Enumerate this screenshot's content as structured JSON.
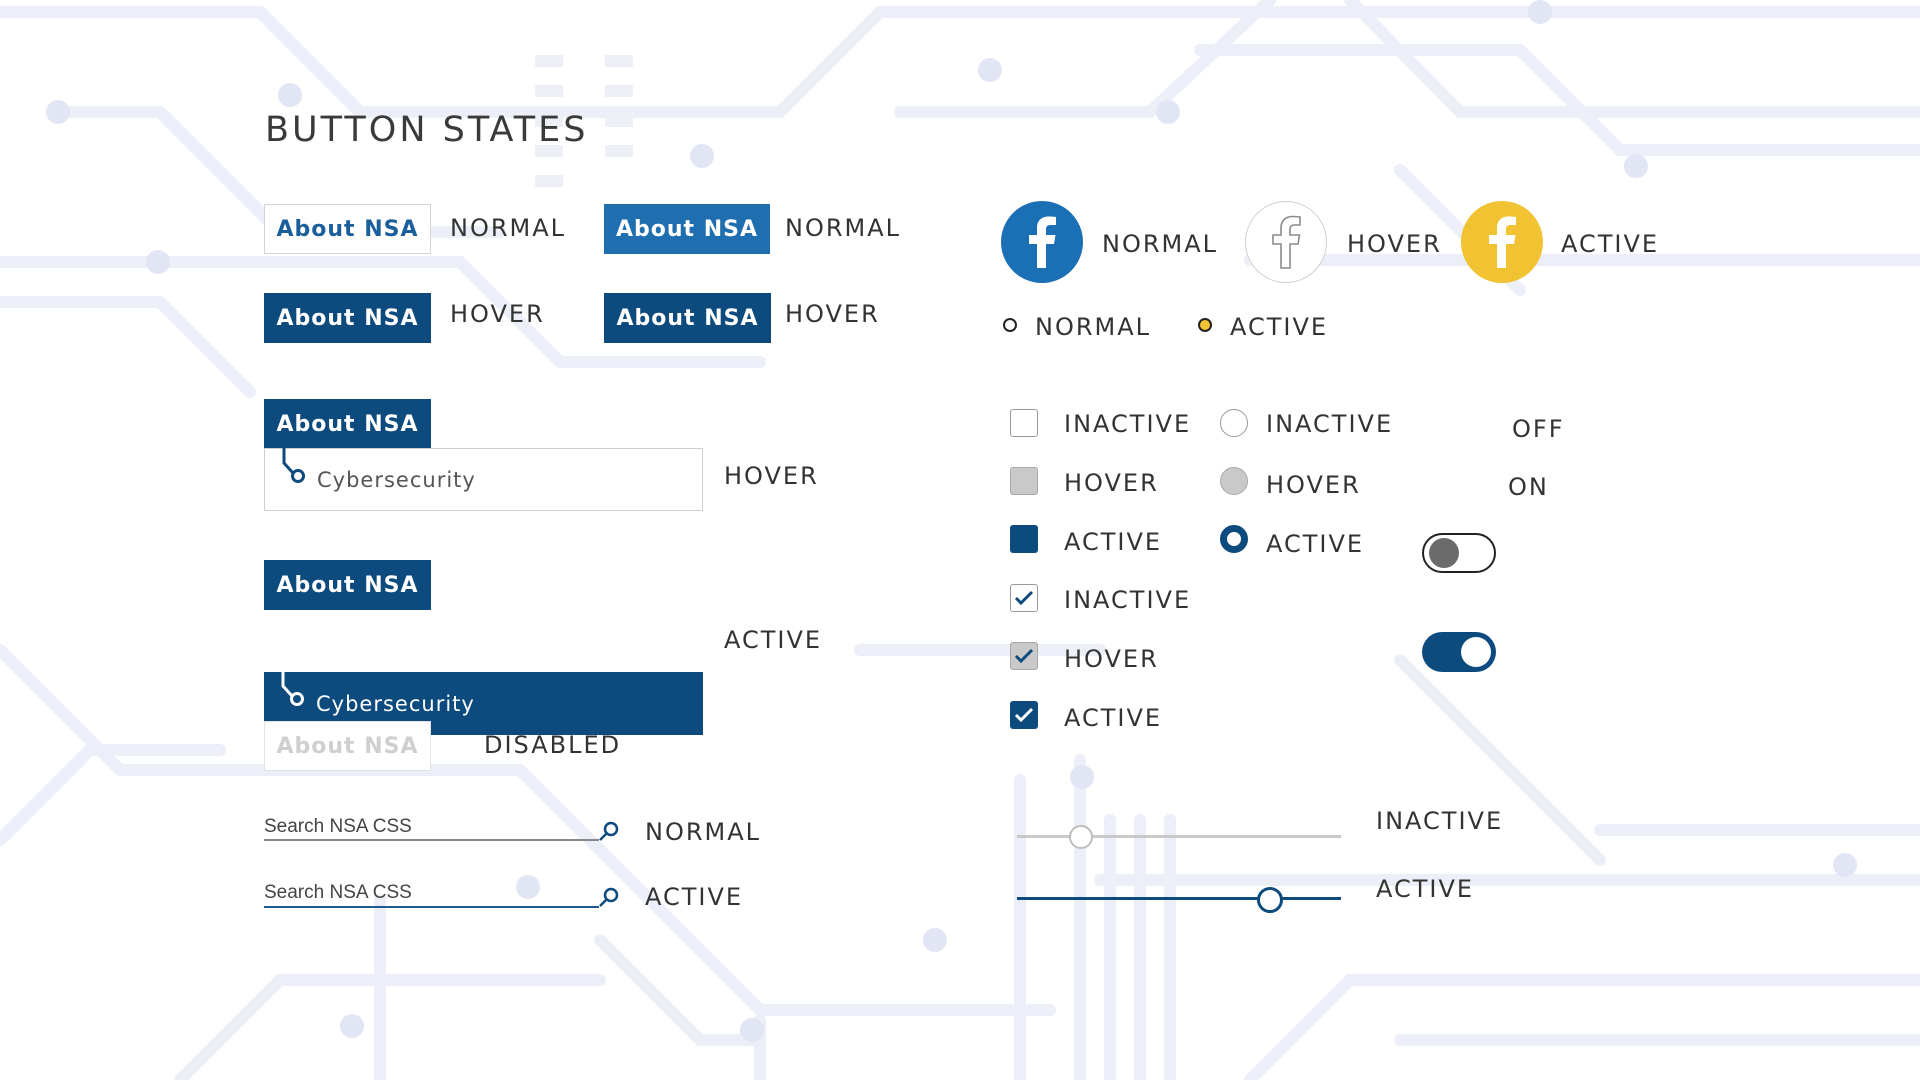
{
  "page": {
    "title": "BUTTON STATES"
  },
  "buttons": {
    "normal_outline": {
      "label": "About NSA",
      "state": "NORMAL"
    },
    "normal_filled": {
      "label": "About NSA",
      "state": "NORMAL"
    },
    "hover_1": {
      "label": "About NSA",
      "state": "HOVER"
    },
    "hover_2": {
      "label": "About NSA",
      "state": "HOVER"
    },
    "dropdown_hover": {
      "label": "About NSA",
      "item": "Cybersecurity",
      "state": "HOVER"
    },
    "dropdown_active": {
      "label": "About NSA",
      "item": "Cybersecurity",
      "state": "ACTIVE"
    },
    "disabled": {
      "label": "About NSA",
      "state": "DISABLED"
    }
  },
  "search": {
    "normal": {
      "placeholder": "Search NSA CSS",
      "state": "NORMAL"
    },
    "active": {
      "placeholder": "Search NSA CSS",
      "state": "ACTIVE"
    }
  },
  "social": {
    "normal": {
      "state": "NORMAL",
      "icon": "facebook-icon"
    },
    "hover": {
      "state": "HOVER",
      "icon": "facebook-icon"
    },
    "active": {
      "state": "ACTIVE",
      "icon": "facebook-icon"
    }
  },
  "small_radios": {
    "normal": "NORMAL",
    "active": "ACTIVE"
  },
  "checkboxes": {
    "inactive": "INACTIVE",
    "hover": "HOVER",
    "active": "ACTIVE",
    "checked_inactive": "INACTIVE",
    "checked_hover": "HOVER",
    "checked_active": "ACTIVE"
  },
  "radios": {
    "inactive": "INACTIVE",
    "hover": "HOVER",
    "active": "ACTIVE"
  },
  "toggles": {
    "off": "OFF",
    "on": "ON"
  },
  "sliders": {
    "inactive": {
      "state": "INACTIVE",
      "value": 0.2
    },
    "active": {
      "state": "ACTIVE",
      "value": 0.78
    }
  },
  "colors": {
    "primary": "#1f6eb0",
    "dark": "#0d4a7d",
    "facebook": "#1a6fb5",
    "yellow": "#f1c232",
    "gray": "#c9c9c9"
  }
}
